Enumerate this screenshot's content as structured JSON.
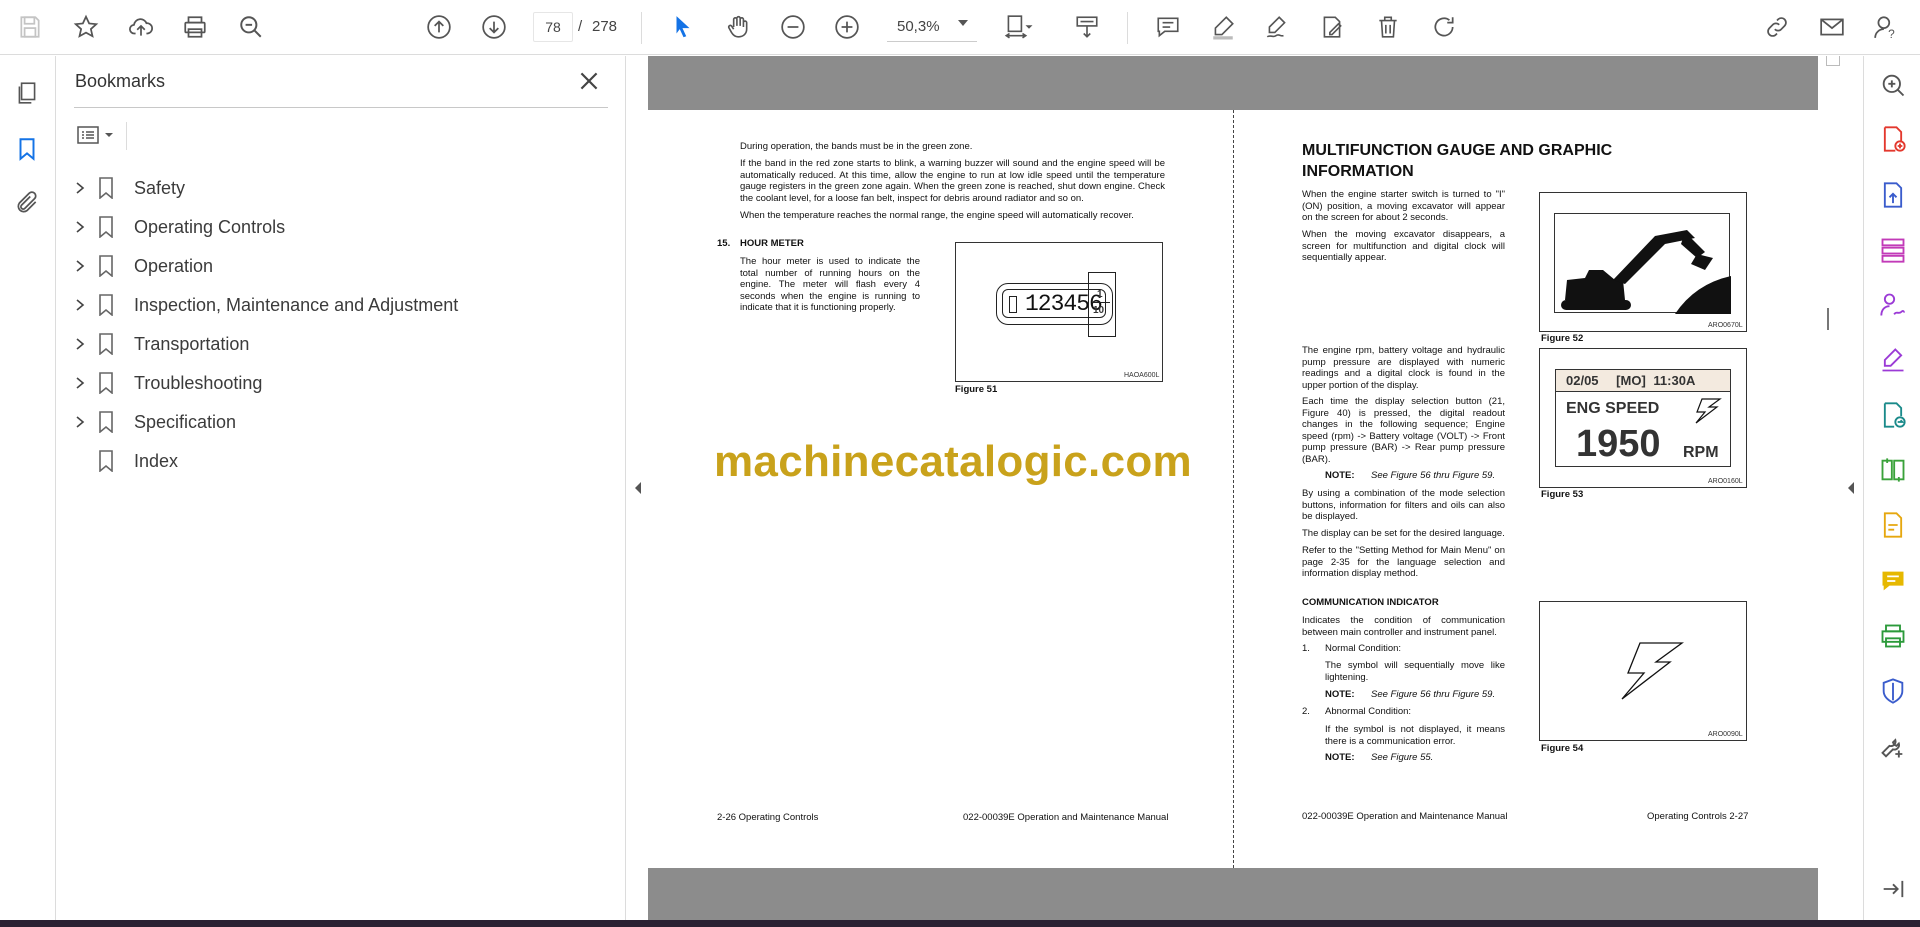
{
  "toolbar": {
    "page_current": "78",
    "page_separator": "/",
    "page_total": "278",
    "zoom": "50,3%"
  },
  "bookmarks": {
    "title": "Bookmarks",
    "items": [
      {
        "label": "Safety",
        "expandable": true
      },
      {
        "label": "Operating Controls",
        "expandable": true
      },
      {
        "label": "Operation",
        "expandable": true
      },
      {
        "label": "Inspection, Maintenance and Adjustment",
        "expandable": true
      },
      {
        "label": "Transportation",
        "expandable": true
      },
      {
        "label": "Troubleshooting",
        "expandable": true
      },
      {
        "label": "Specification",
        "expandable": true
      },
      {
        "label": "Index",
        "expandable": false
      }
    ]
  },
  "page_left": {
    "p1": "During operation, the bands must be in the green zone.",
    "p2": "If the band in the red zone starts to blink, a warning buzzer will sound and the engine speed will be automatically reduced. At this time, allow the engine to run at low idle speed until the temperature gauge registers in the green zone again. When the green zone is reached, shut down engine. Check the coolant level, for a loose fan belt, inspect for debris around radiator and so on.",
    "p3": "When the temperature reaches the normal range, the engine speed will automatically recover.",
    "section_num": "15.",
    "section_title": "HOUR METER",
    "section_body": "The hour meter is used to indicate the total number of running hours on the engine. The meter will flash every 4 seconds when the engine is running to indicate that it is functioning properly.",
    "meter_digits": "123456",
    "meter_frac_top": "1",
    "meter_frac_bottom": "10",
    "fig51_code": "HAOA600L",
    "fig51_caption": "Figure 51",
    "footer_left": "2-26  Operating Controls",
    "footer_right": "022-00039E Operation and Maintenance Manual"
  },
  "watermark": "machinecatalogic.com",
  "page_right": {
    "title": "MULTIFUNCTION GAUGE AND GRAPHIC INFORMATION",
    "p1": "When the engine starter switch is turned to \"I\" (ON) position, a moving excavator will appear on the screen for about 2 seconds.",
    "p2": "When the moving excavator disappears, a screen for multifunction and digital clock will sequentially appear.",
    "p3": "The engine rpm, battery voltage and hydraulic pump pressure are displayed with numeric readings and a digital clock is found in the upper portion of the display.",
    "p4": "Each time the display selection button (21, Figure 40) is pressed, the digital readout changes in the following sequence; Engine speed (rpm) -> Battery voltage (VOLT) -> Front pump pressure (BAR) -> Rear pump pressure (BAR).",
    "note_label": "NOTE:",
    "note1": "See Figure 56 thru Figure 59.",
    "p5": "By using a combination of the mode selection buttons, information for filters and oils can also be displayed.",
    "p6": "The display can be set for the desired language.",
    "p7": "Refer to the \"Setting Method for Main Menu\" on page 2-35 for the language selection and information display method.",
    "comm_title": "COMMUNICATION INDICATOR",
    "comm_body": "Indicates the condition of communication between main controller and instrument panel.",
    "item1_num": "1.",
    "item1_title": "Normal Condition:",
    "item1_body": "The symbol will sequentially move like lightening.",
    "note2": "See Figure 56 thru Figure 59.",
    "item2_num": "2.",
    "item2_title": "Abnormal Condition:",
    "item2_body": "If the symbol is not displayed, it means there is a communication error.",
    "note3": "See Figure 55.",
    "fig52_code": "ARO0670L",
    "fig52_caption": "Figure 52",
    "display_date": "02/05",
    "display_day": "[MO]",
    "display_time": "11:30A",
    "display_label": "ENG SPEED",
    "display_value": "1950",
    "display_unit": "RPM",
    "fig53_code": "ARO0160L",
    "fig53_caption": "Figure 53",
    "fig54_code": "ARO0090L",
    "fig54_caption": "Figure 54",
    "footer_left": "022-00039E Operation and Maintenance Manual",
    "footer_right": "Operating Controls 2-27"
  },
  "colors": {
    "accent_blue": "#1473e6",
    "watermark": "#c9a21b",
    "gray_gutter": "#8c8c8c"
  }
}
